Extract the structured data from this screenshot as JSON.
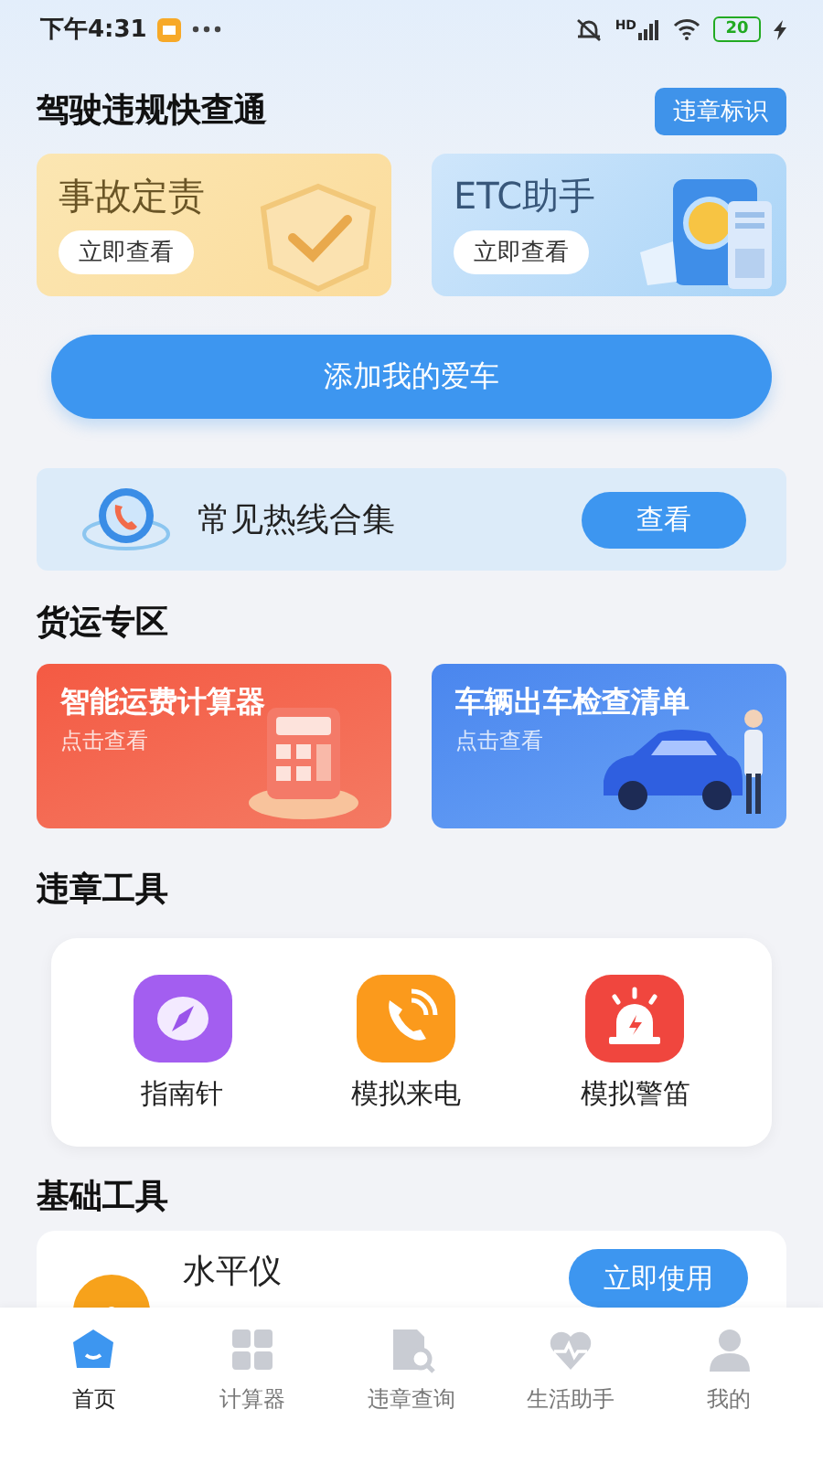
{
  "status_bar": {
    "time": "下午4:31",
    "network": "HD",
    "battery": "20"
  },
  "driving": {
    "title": "驾驶违规快查通",
    "action": "违章标识",
    "cards": [
      {
        "title": "事故定责",
        "button": "立即查看",
        "kind": "shield"
      },
      {
        "title": "ETC助手",
        "button": "立即查看",
        "kind": "etc"
      }
    ]
  },
  "add_car_button": "添加我的爱车",
  "hotline": {
    "title": "常见热线合集",
    "button": "查看"
  },
  "freight": {
    "title": "货运专区",
    "cards": [
      {
        "title": "智能运费计算器",
        "subtitle": "点击查看",
        "kind": "calculator"
      },
      {
        "title": "车辆出车检查清单",
        "subtitle": "点击查看",
        "kind": "car"
      }
    ]
  },
  "violation_tools": {
    "title": "违章工具",
    "tools": [
      {
        "label": "指南针",
        "kind": "compass"
      },
      {
        "label": "模拟来电",
        "kind": "call"
      },
      {
        "label": "模拟警笛",
        "kind": "siren"
      }
    ]
  },
  "basic_tools": {
    "title": "基础工具",
    "items": [
      {
        "title": "水平仪",
        "button": "立即使用"
      }
    ]
  },
  "bottom_nav": [
    {
      "label": "首页",
      "kind": "home",
      "selected": true
    },
    {
      "label": "计算器",
      "kind": "calculator",
      "selected": false
    },
    {
      "label": "违章查询",
      "kind": "search",
      "selected": false
    },
    {
      "label": "生活助手",
      "kind": "heart",
      "selected": false
    },
    {
      "label": "我的",
      "kind": "user",
      "selected": false
    }
  ]
}
